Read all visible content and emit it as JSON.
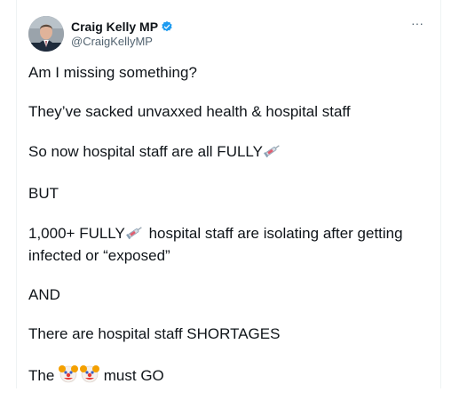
{
  "tweet": {
    "author": {
      "display_name": "Craig Kelly MP",
      "handle": "@CraigKellyMP",
      "verified": true
    },
    "more_icon": "more-dots-icon",
    "lines": [
      {
        "text": "Am I missing something?"
      },
      {
        "text": "They’ve sacked unvaxxed health & hospital staff"
      },
      {
        "before": "So now hospital staff are all FULLY",
        "emoji": "syringe",
        "after": ""
      },
      {
        "text": "BUT"
      },
      {
        "before": "1,000+ FULLY",
        "emoji": "syringe",
        "after": " hospital staff are isolating after getting infected or “exposed”"
      },
      {
        "text": "AND"
      },
      {
        "text": "There are hospital staff SHORTAGES"
      },
      {
        "before": "The ",
        "emoji": "clown-clown",
        "after": " must GO"
      }
    ]
  },
  "colors": {
    "verified_blue": "#1d9bf0",
    "text_primary": "#0f1419",
    "text_secondary": "#536471",
    "divider": "#eff3f4"
  }
}
